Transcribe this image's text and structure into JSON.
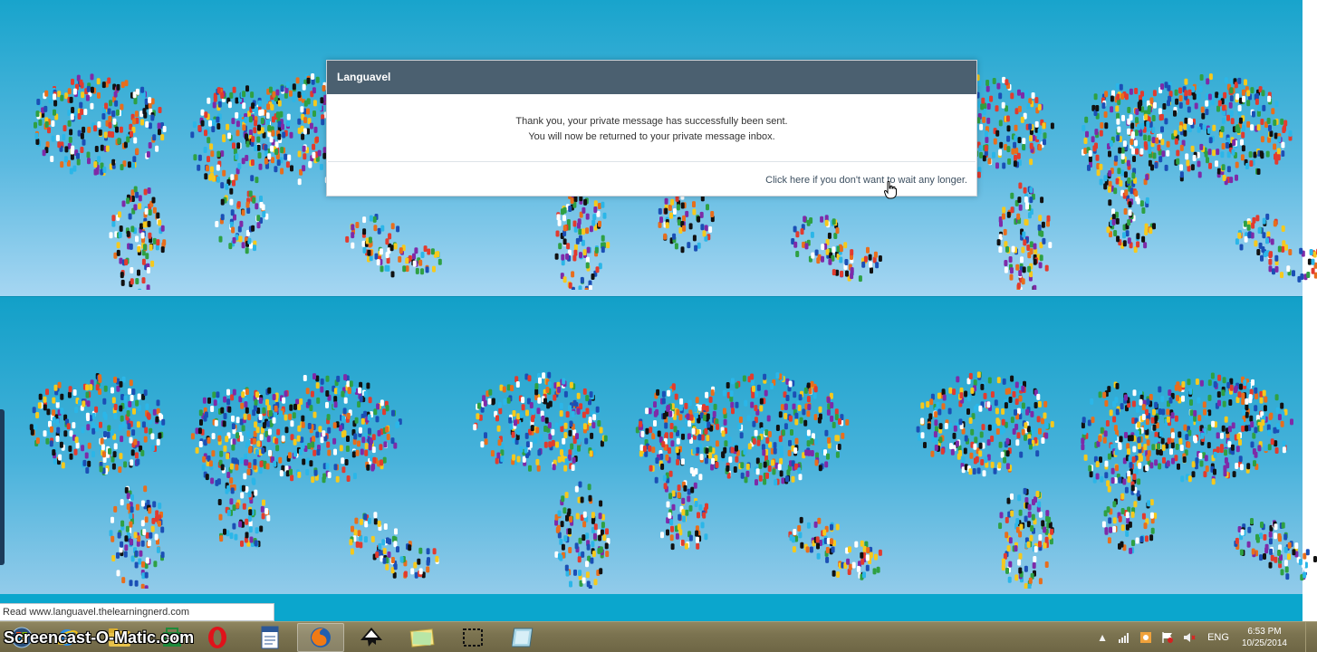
{
  "dialog": {
    "title": "Languavel",
    "message_line1": "Thank you, your private message has successfully been sent.",
    "message_line2": "You will now be returned to your private message inbox.",
    "link_text": "Click here if you don't want to wait any longer."
  },
  "statusbar": {
    "text": "Read www.languavel.thelearningnerd.com"
  },
  "taskbar": {
    "watermark": "Screencast-O-Matic.com",
    "apps": [
      {
        "name": "Opera",
        "icon": "opera-icon"
      },
      {
        "name": "Document",
        "icon": "document-icon"
      },
      {
        "name": "Firefox",
        "icon": "firefox-icon",
        "active": true
      },
      {
        "name": "Inkscape",
        "icon": "inkscape-icon"
      },
      {
        "name": "Notes",
        "icon": "notes-icon"
      },
      {
        "name": "Snipping Tool",
        "icon": "snip-icon"
      },
      {
        "name": "Tablet",
        "icon": "tablet-icon"
      }
    ],
    "tray": {
      "language": "ENG",
      "time": "6:53 PM",
      "date": "10/25/2014"
    }
  },
  "colors": {
    "dialog_header": "#4b6070",
    "background": "#18a4cc",
    "taskbar": "#7b7350"
  }
}
